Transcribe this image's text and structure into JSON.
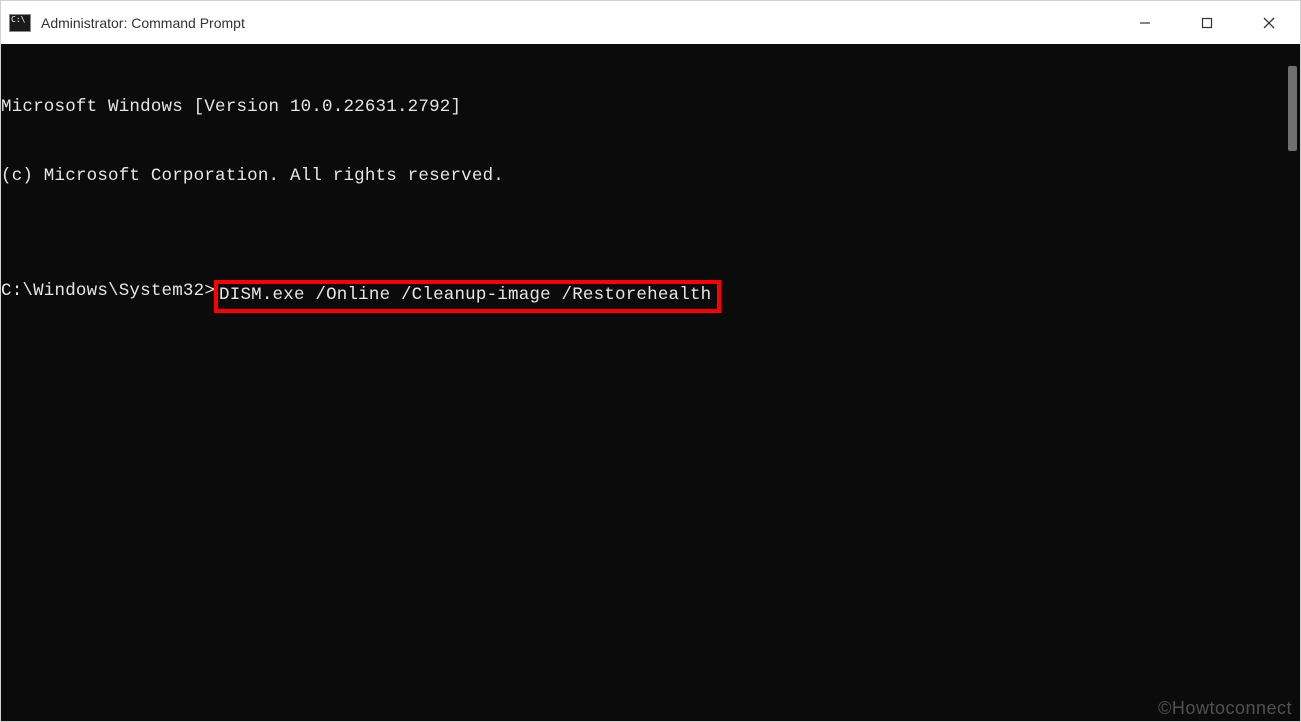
{
  "window": {
    "title": "Administrator: Command Prompt"
  },
  "controls": {
    "minimize": "minimize",
    "maximize": "maximize",
    "close": "close"
  },
  "terminal": {
    "line1": "Microsoft Windows [Version 10.0.22631.2792]",
    "line2": "(c) Microsoft Corporation. All rights reserved.",
    "blank": "",
    "prompt_prefix": "C:\\Windows\\System32>",
    "command": "DISM.exe /Online /Cleanup-image /Restorehealth"
  },
  "watermark": "©Howtoconnect"
}
